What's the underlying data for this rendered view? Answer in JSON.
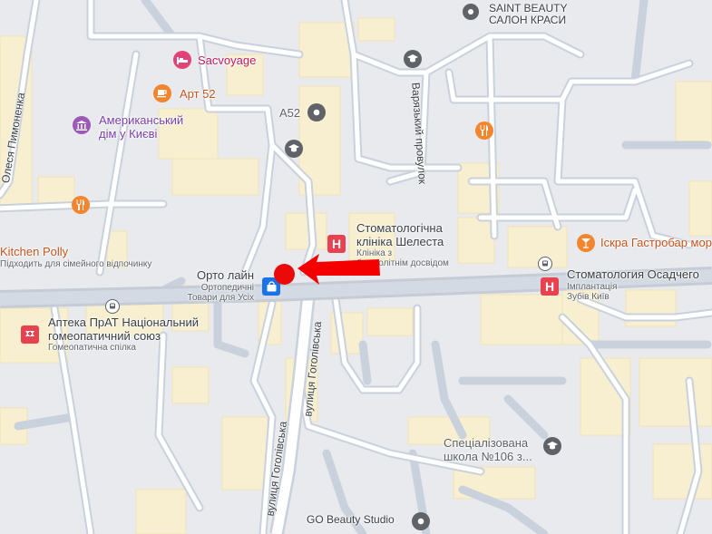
{
  "streets": {
    "pymonenka": "Олеся Пимоненка",
    "varazkyi": "Варязький провулок",
    "hoholivska_upper": "вулиця Гоголівська",
    "hoholivska_lower": "вулиця Гоголівська"
  },
  "places": {
    "saint_beauty": "SAINT BEAUTY САЛОН КРАСИ",
    "sacvoyage": "Sacvoyage",
    "art52": "Арт 52",
    "a52": "A52",
    "american_house_1": "Американський",
    "american_house_2": "дім у Києві",
    "kitchen_polly": "Kitchen Polly",
    "kitchen_polly_sub": "Підходить для сімейного відпочинку",
    "stoma_shelest_1": "Стоматологічна",
    "stoma_shelest_2": "клініка Шелеста",
    "stoma_shelest_sub1": "Клініка з",
    "stoma_shelest_sub2": "багатолітнім досвідом",
    "iskra": "Іскра Гастробар морепродуктів",
    "orto_lain": "Орто лайн",
    "orto_sub1": "Ортопедичні",
    "orto_sub2": "Товари для Усіх",
    "stoma_osadchego": "Стоматология Осадчего",
    "stoma_osad_sub1": "Імплантація",
    "stoma_osad_sub2": "Зубів Київ",
    "apteka_1": "Аптека ПрАТ Національний",
    "apteka_2": "гомеопатичний союз",
    "apteka_sub": "Гомеопатична спілка",
    "school_1": "Спеціалізована",
    "school_2": "школа №106 з...",
    "go_beauty": "GO Beauty Studio"
  },
  "colors": {
    "road": "#ffffff",
    "road_main": "#c5ccd6",
    "building": "#f7efcf",
    "background": "#e8eaed",
    "marker": "#ea0a0a",
    "arrow": "#f40000",
    "poi_pink": "#e04378",
    "poi_orange": "#f2852e",
    "poi_purple": "#9c59b6",
    "poi_grey": "#5f6368",
    "poi_red": "#e8414f",
    "shop_blue": "#1a73e8"
  },
  "icons": {
    "hotel": "bed-icon",
    "cafe": "coffee-cup-icon",
    "museum": "museum-icon",
    "education": "graduation-cap-icon",
    "restaurant": "fork-knife-icon",
    "bar": "cocktail-icon",
    "hospital": "hospital-h-icon",
    "shop": "shopping-bag-icon",
    "pharmacy": "pharmacy-icon",
    "landmark": "landmark-icon",
    "bus": "bus-stop-icon"
  }
}
